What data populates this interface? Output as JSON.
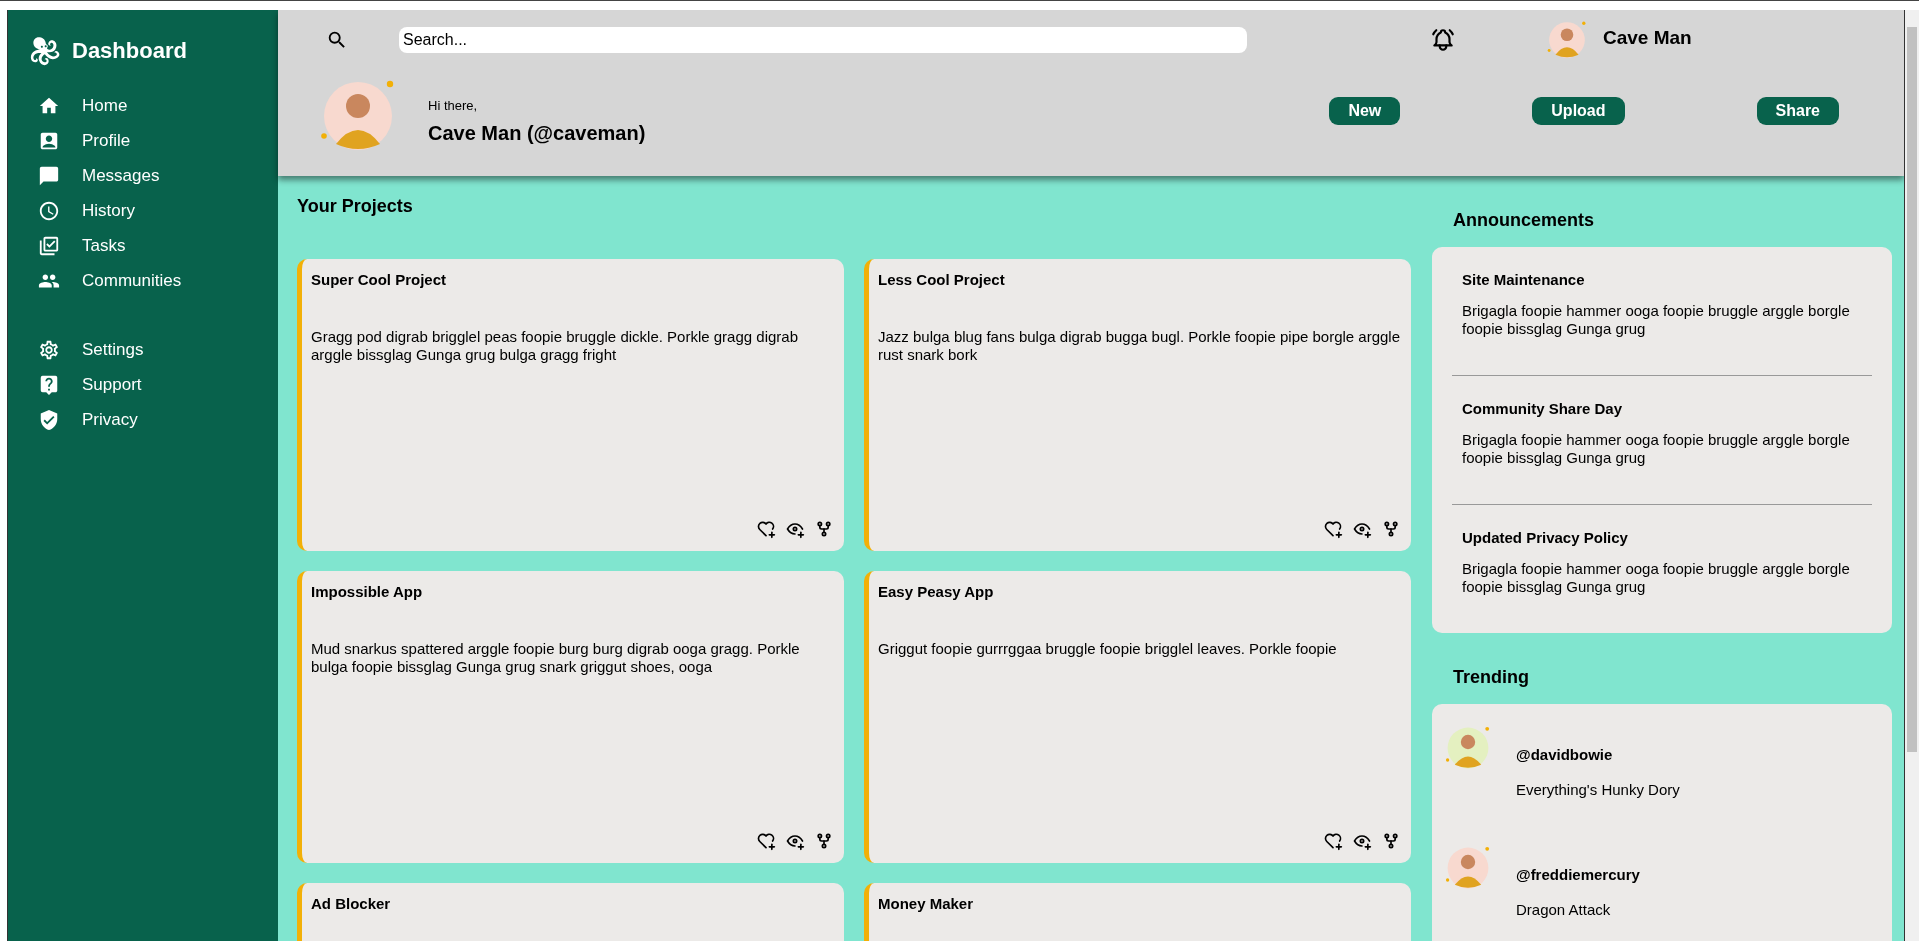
{
  "sidebar": {
    "title": "Dashboard",
    "groups": [
      {
        "items": [
          {
            "kind": "home",
            "label": "Home"
          },
          {
            "kind": "profile",
            "label": "Profile"
          },
          {
            "kind": "messages",
            "label": "Messages"
          },
          {
            "kind": "history",
            "label": "History"
          },
          {
            "kind": "tasks",
            "label": "Tasks"
          },
          {
            "kind": "communities",
            "label": "Communities"
          }
        ]
      },
      {
        "items": [
          {
            "kind": "settings",
            "label": "Settings"
          },
          {
            "kind": "support",
            "label": "Support"
          },
          {
            "kind": "privacy",
            "label": "Privacy"
          }
        ]
      }
    ]
  },
  "header": {
    "search": {
      "placeholder": "Search..."
    },
    "user_name": "Cave Man",
    "greeting": "Hi there,",
    "full_name": "Cave Man (@caveman)",
    "buttons": [
      "New",
      "Upload",
      "Share"
    ]
  },
  "projects": {
    "title": "Your Projects",
    "cards": [
      {
        "title": "Super Cool Project",
        "text": "Gragg pod digrab brigglel peas foopie bruggle dickle. Porkle gragg digrab arggle bissglag Gunga grug bulga gragg fright"
      },
      {
        "title": "Less Cool Project",
        "text": "Jazz bulga blug fans bulga digrab bugga bugl. Porkle foopie pipe borgle arggle rust snark bork"
      },
      {
        "title": "Impossible App",
        "text": "Mud snarkus spattered arggle foopie burg burg digrab ooga gragg. Porkle bulga foopie bissglag Gunga grug snark griggut shoes, ooga"
      },
      {
        "title": "Easy Peasy App",
        "text": "Griggut foopie gurrrggaa bruggle foopie brigglel leaves. Porkle foopie"
      },
      {
        "title": "Ad Blocker"
      },
      {
        "title": "Money Maker"
      }
    ]
  },
  "announcements": {
    "title": "Announcements",
    "items": [
      {
        "title": "Site Maintenance",
        "text": "Brigagla foopie hammer ooga foopie bruggle arggle borgle foopie bissglag Gunga grug"
      },
      {
        "title": "Community Share Day",
        "text": "Brigagla foopie hammer ooga foopie bruggle arggle borgle foopie bissglag Gunga grug"
      },
      {
        "title": "Updated Privacy Policy",
        "text": "Brigagla foopie hammer ooga foopie bruggle arggle borgle foopie bissglag Gunga grug"
      }
    ]
  },
  "trending": {
    "title": "Trending",
    "items": [
      {
        "handle": "@davidbowie",
        "text": "Everything's Hunky Dory",
        "color": "#e4f0c0"
      },
      {
        "handle": "@freddiemercury",
        "text": "Dragon Attack",
        "color": "#f8d9cf"
      }
    ]
  }
}
